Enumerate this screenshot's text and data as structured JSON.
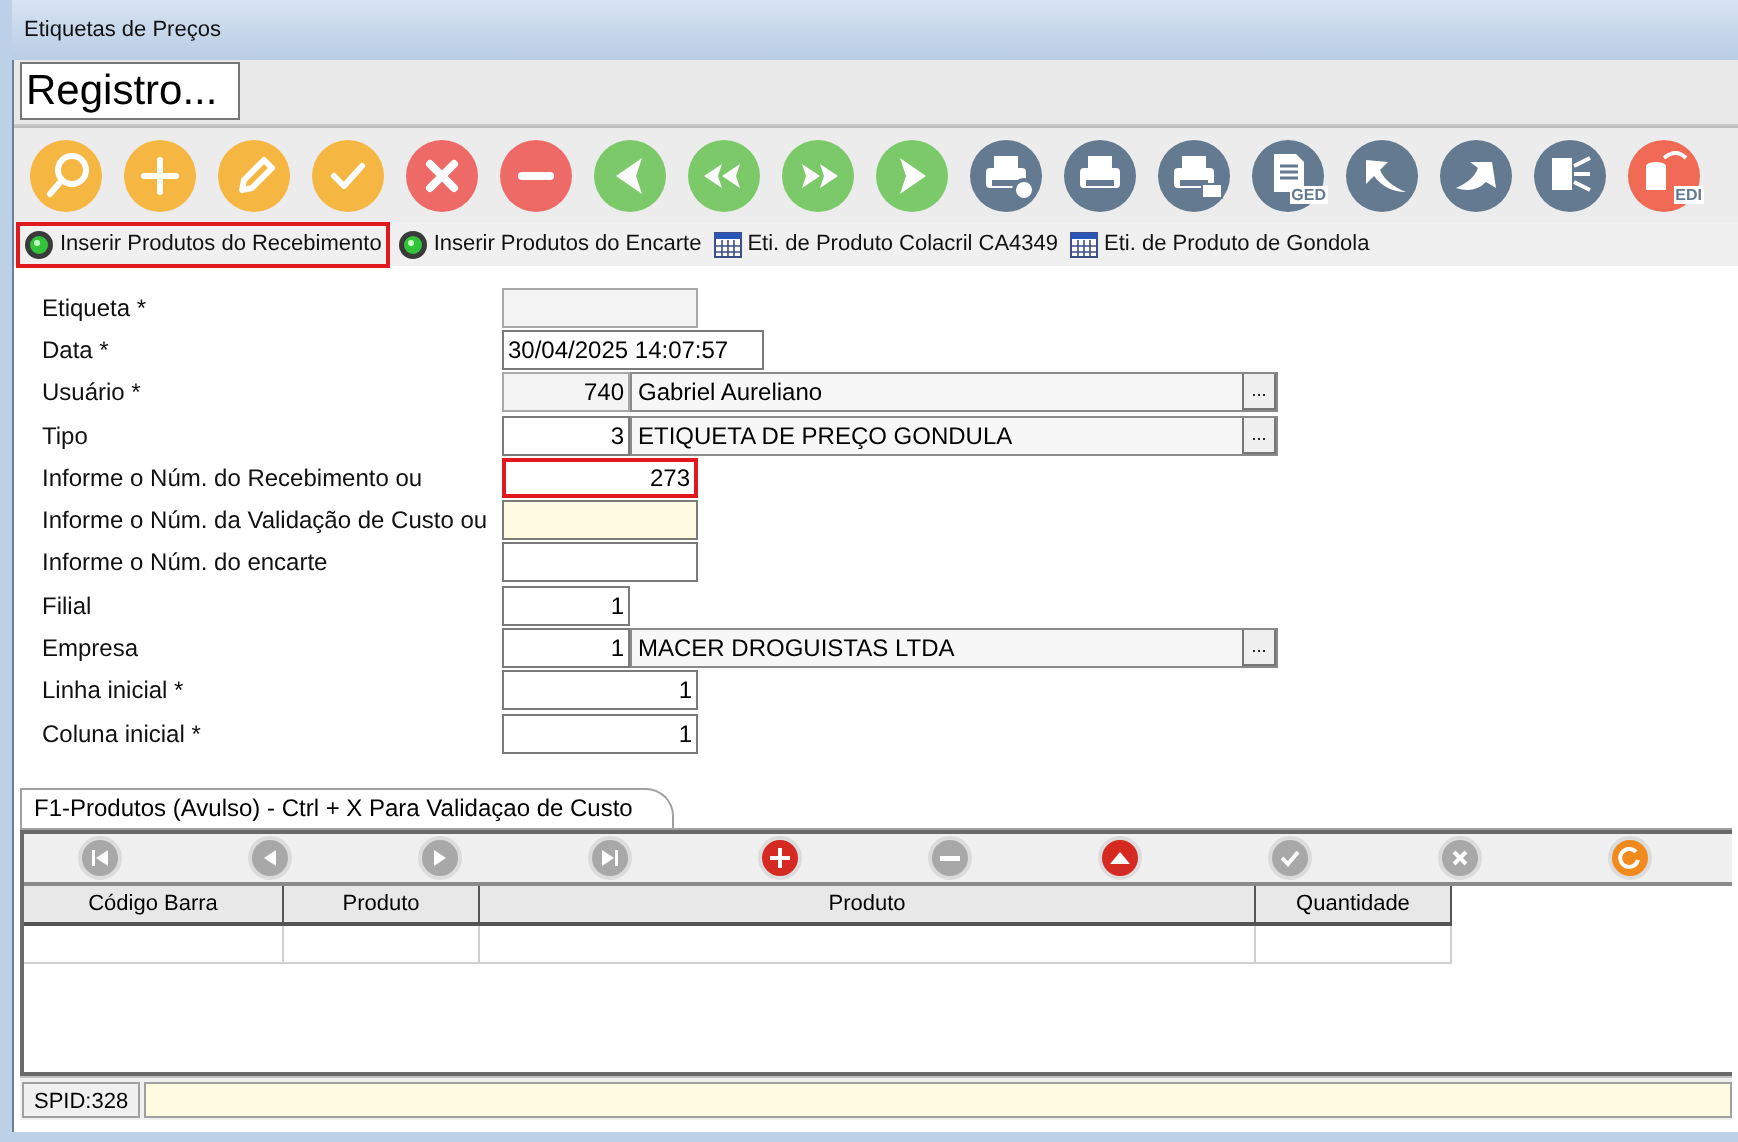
{
  "window": {
    "title": "Etiquetas de Preços"
  },
  "header": {
    "title": "Registro..."
  },
  "toolbar": [
    {
      "kind": "search",
      "color": "#f5b642"
    },
    {
      "kind": "add",
      "color": "#f5b642"
    },
    {
      "kind": "edit",
      "color": "#f5b642"
    },
    {
      "kind": "confirm",
      "color": "#f5b642"
    },
    {
      "kind": "cancel",
      "color": "#ee6a66"
    },
    {
      "kind": "remove",
      "color": "#ee6a66"
    },
    {
      "kind": "prev",
      "color": "#7cc96a"
    },
    {
      "kind": "first",
      "color": "#7cc96a"
    },
    {
      "kind": "last",
      "color": "#7cc96a"
    },
    {
      "kind": "next",
      "color": "#7cc96a"
    },
    {
      "kind": "print_preview",
      "color": "#637a91"
    },
    {
      "kind": "print",
      "color": "#637a91"
    },
    {
      "kind": "print_email",
      "color": "#637a91"
    },
    {
      "kind": "document",
      "color": "#637a91",
      "badge": "GED"
    },
    {
      "kind": "undo",
      "color": "#637a91"
    },
    {
      "kind": "redo",
      "color": "#637a91"
    },
    {
      "kind": "export",
      "color": "#637a91"
    },
    {
      "kind": "database",
      "color": "#f06a55",
      "badge": "EDI"
    }
  ],
  "actions": [
    {
      "kind": "gear",
      "label": "Inserir Produtos do Recebimento",
      "highlighted": true
    },
    {
      "kind": "gear",
      "label": "Inserir Produtos do Encarte",
      "highlighted": false
    },
    {
      "kind": "grid",
      "label": "Eti. de Produto Colacril CA4349",
      "highlighted": false
    },
    {
      "kind": "grid",
      "label": "Eti. de Produto de Gondola",
      "highlighted": false
    }
  ],
  "fields": [
    {
      "kind": "text",
      "label": "Etiqueta *",
      "disabled": true,
      "highlighted": false,
      "focused": false
    },
    {
      "kind": "date",
      "label": "Data *",
      "value": "30/04/2025 14:07:57",
      "disabled": false,
      "highlighted": false,
      "focused": false
    },
    {
      "kind": "lookup",
      "label": "Usuário *",
      "value": "740",
      "description": "Gabriel Aureliano",
      "disabled": true,
      "highlighted": false,
      "focused": false
    },
    {
      "kind": "lookup",
      "label": "Tipo",
      "value": "3",
      "description": "ETIQUETA DE PREÇO GONDULA",
      "disabled": false,
      "highlighted": false,
      "focused": false
    },
    {
      "kind": "text",
      "label": "Informe o Núm. do Recebimento ou",
      "value": "273",
      "disabled": false,
      "highlighted": true,
      "focused": false
    },
    {
      "kind": "text",
      "label": "Informe o Núm. da Validação de Custo ou",
      "disabled": false,
      "highlighted": false,
      "focused": true
    },
    {
      "kind": "text",
      "label": "Informe o Núm. do encarte",
      "disabled": false,
      "highlighted": false,
      "focused": false
    },
    {
      "kind": "short",
      "label": "Filial",
      "value": "1",
      "disabled": false,
      "highlighted": false,
      "focused": false
    },
    {
      "kind": "lookup",
      "label": "Empresa",
      "value": "1",
      "description": "MACER DROGUISTAS LTDA",
      "disabled": false,
      "highlighted": false,
      "focused": false
    },
    {
      "kind": "text",
      "label": "Linha inicial *",
      "value": "1",
      "disabled": false,
      "highlighted": false,
      "focused": false
    },
    {
      "kind": "text",
      "label": "Coluna inicial *",
      "value": "1",
      "disabled": false,
      "highlighted": false,
      "focused": false
    }
  ],
  "lookup_button": "...",
  "grid_tab": {
    "label": "F1-Produtos (Avulso) - Ctrl + X Para Validaçao de Custo"
  },
  "grid_toolbar": [
    {
      "kind": "first",
      "disabled": true
    },
    {
      "kind": "prev",
      "disabled": true
    },
    {
      "kind": "next",
      "disabled": true
    },
    {
      "kind": "last",
      "disabled": true
    },
    {
      "kind": "add",
      "disabled": false
    },
    {
      "kind": "remove",
      "disabled": true
    },
    {
      "kind": "up",
      "disabled": false
    },
    {
      "kind": "confirm",
      "disabled": true
    },
    {
      "kind": "cancel",
      "disabled": true
    },
    {
      "kind": "refresh",
      "disabled": false
    }
  ],
  "table": {
    "columns": [
      "Código Barra",
      "Produto",
      "Produto",
      "Quantidade"
    ]
  },
  "status_bar": {
    "spid": "SPID:328"
  }
}
